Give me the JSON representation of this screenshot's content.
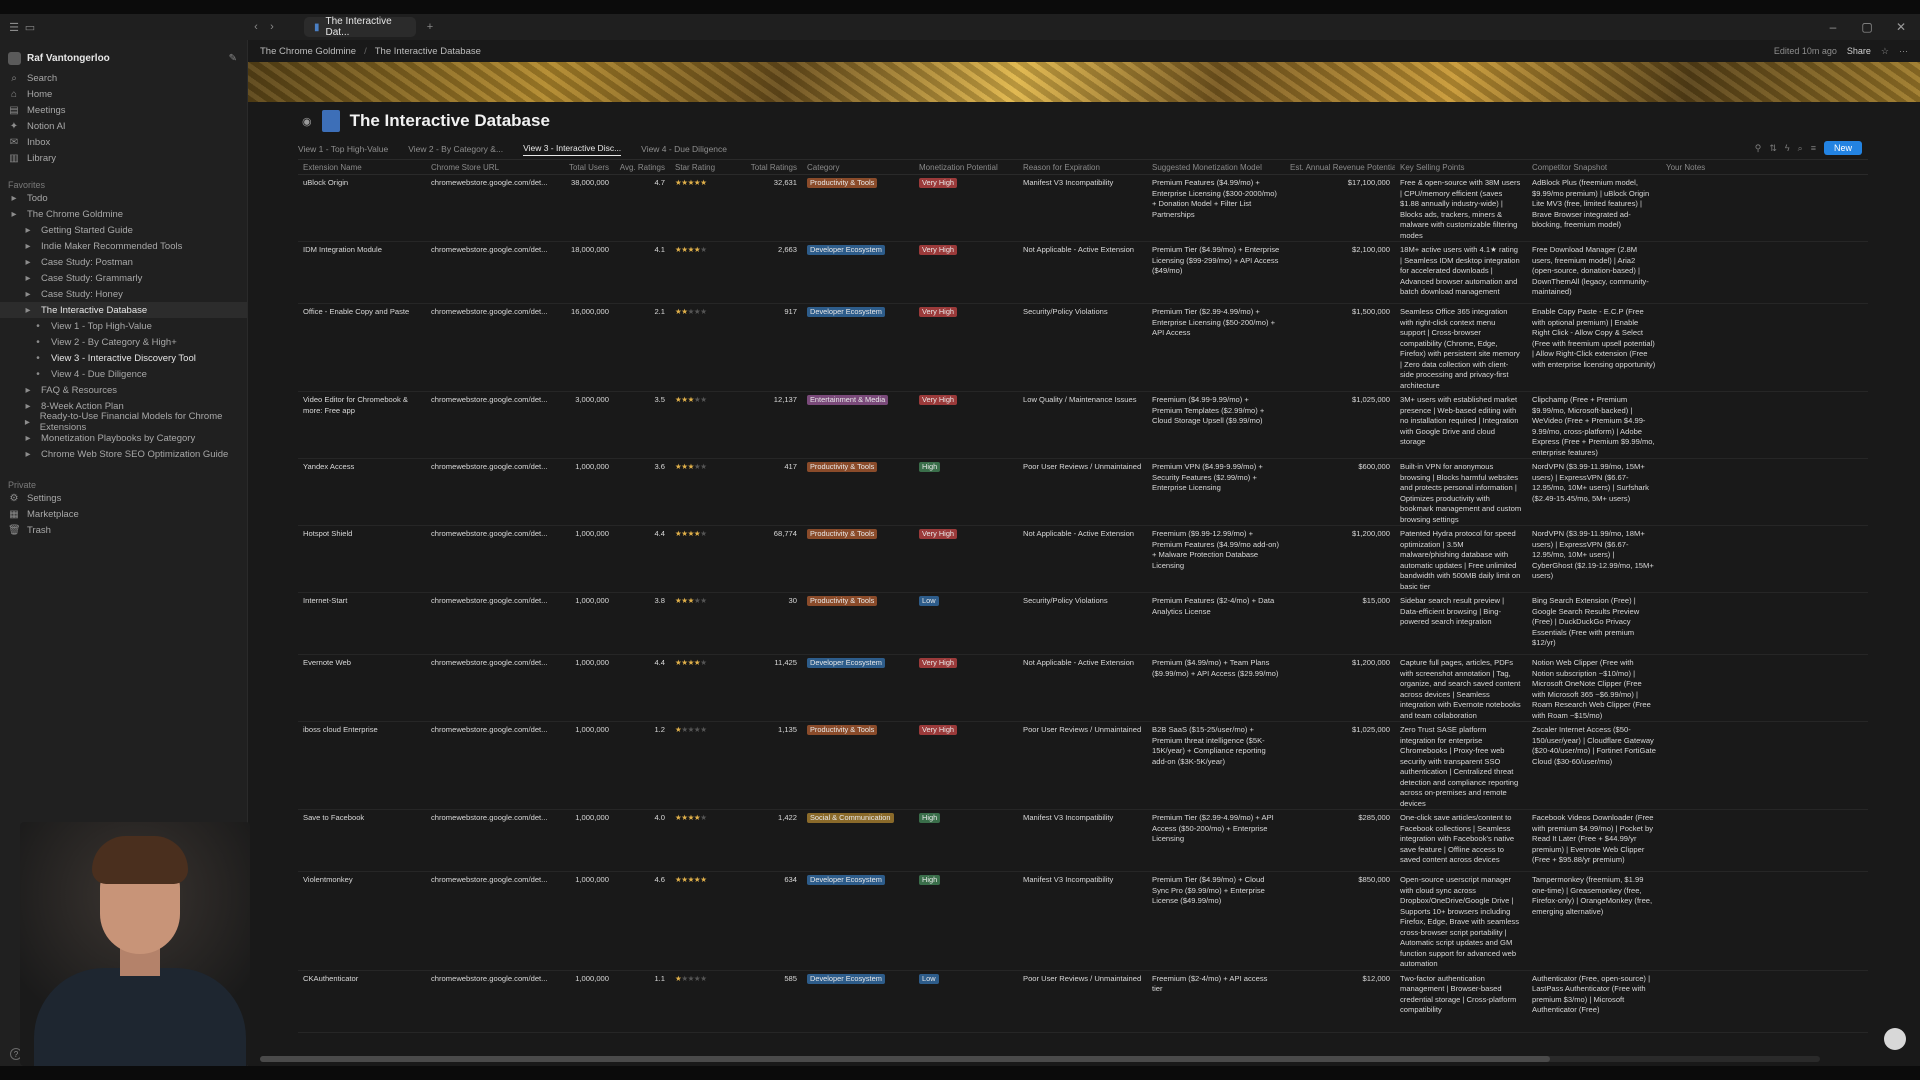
{
  "window": {
    "tab_title": "The Interactive Dat...",
    "new_tab": "+"
  },
  "sidebar": {
    "workspace": "Raf Vantongerloo",
    "top_items": [
      {
        "icon": "search-icon",
        "glyph": "⌕",
        "label": "Search"
      },
      {
        "icon": "home-icon",
        "glyph": "⌂",
        "label": "Home"
      },
      {
        "icon": "meetings-icon",
        "glyph": "▤",
        "label": "Meetings"
      },
      {
        "icon": "notion-ai-icon",
        "glyph": "✦",
        "label": "Notion AI"
      },
      {
        "icon": "inbox-icon",
        "glyph": "✉",
        "label": "Inbox"
      },
      {
        "icon": "library-icon",
        "glyph": "▥",
        "label": "Library"
      }
    ],
    "favorites_label": "Favorites",
    "favorites": [
      {
        "label": "Todo",
        "level": 0
      },
      {
        "label": "The Chrome Goldmine",
        "level": 0
      },
      {
        "label": "Getting Started Guide",
        "level": 1
      },
      {
        "label": "Indie Maker Recommended Tools",
        "level": 1
      },
      {
        "label": "Case Study: Postman",
        "level": 1
      },
      {
        "label": "Case Study: Grammarly",
        "level": 1
      },
      {
        "label": "Case Study: Honey",
        "level": 1
      },
      {
        "label": "The Interactive Database",
        "level": 1,
        "active": true
      },
      {
        "label": "View 1 - Top High-Value",
        "level": 2
      },
      {
        "label": "View 2 - By Category & High+",
        "level": 2
      },
      {
        "label": "View 3 - Interactive Discovery Tool",
        "level": 2,
        "bold": true
      },
      {
        "label": "View 4 - Due Diligence",
        "level": 2
      },
      {
        "label": "FAQ & Resources",
        "level": 1
      },
      {
        "label": "8-Week Action Plan",
        "level": 1
      },
      {
        "label": "Ready-to-Use Financial Models for Chrome Extensions",
        "level": 1
      },
      {
        "label": "Monetization Playbooks by Category",
        "level": 1
      },
      {
        "label": "Chrome Web Store SEO Optimization Guide",
        "level": 1
      }
    ],
    "private_label": "Private",
    "bottom_items": [
      {
        "icon": "settings-icon",
        "glyph": "⚙",
        "label": "Settings"
      },
      {
        "icon": "marketplace-icon",
        "glyph": "▦",
        "label": "Marketplace"
      },
      {
        "icon": "trash-icon",
        "glyph": "🗑",
        "label": "Trash"
      }
    ]
  },
  "topbar": {
    "breadcrumb_1": "The Chrome Goldmine",
    "breadcrumb_2": "The Interactive Database",
    "edited": "Edited 10m ago",
    "share": "Share"
  },
  "page": {
    "title": "The Interactive Database",
    "views": [
      "View 1 - Top High-Value",
      "View 2 - By Category &...",
      "View 3 - Interactive Disc...",
      "View 4 - Due Diligence"
    ],
    "active_view": 2,
    "new_button": "New"
  },
  "table": {
    "columns": [
      "Extension Name",
      "Chrome Store URL",
      "Total Users",
      "Avg. Ratings",
      "Star Rating",
      "Total Ratings",
      "Category",
      "Monetization Potential",
      "Reason for Expiration",
      "Suggested Monetization Model",
      "Est. Annual Revenue Potential",
      "Key Selling Points",
      "Competitor Snapshot",
      "Your Notes"
    ],
    "rows": [
      {
        "name": "uBlock Origin",
        "url": "chromewebstore.google.com/det...",
        "users": "38,000,000",
        "avg": "4.7",
        "stars": 5,
        "ratings": "32,631",
        "category": "Productivity & Tools",
        "cat_color": "#8a4b2a",
        "potential": "Very High",
        "pot_color": "#9b3a3a",
        "reason": "Manifest V3 Incompatibility",
        "model": "Premium Features ($4.99/mo) + Enterprise Licensing ($300-2000/mo) + Donation Model + Filter List Partnerships",
        "revenue": "$17,100,000",
        "points": "Free & open-source with 38M users | CPU/memory efficient (saves $1.88 annually industry-wide) | Blocks ads, trackers, miners & malware with customizable filtering modes",
        "competitor": "AdBlock Plus (freemium model, $9.99/mo premium) | uBlock Origin Lite MV3 (free, limited features) | Brave Browser integrated ad-blocking, freemium model)"
      },
      {
        "name": "IDM Integration Module",
        "url": "chromewebstore.google.com/det...",
        "users": "18,000,000",
        "avg": "4.1",
        "stars": 4,
        "ratings": "2,663",
        "category": "Developer Ecosystem",
        "cat_color": "#2d5c8a",
        "potential": "Very High",
        "pot_color": "#9b3a3a",
        "reason": "Not Applicable - Active Extension",
        "model": "Premium Tier ($4.99/mo) + Enterprise Licensing ($99-299/mo) + API Access ($49/mo)",
        "revenue": "$2,100,000",
        "points": "18M+ active users with 4.1★ rating | Seamless IDM desktop integration for accelerated downloads | Advanced browser automation and batch download management",
        "competitor": "Free Download Manager (2.8M users, freemium model) | Aria2 (open-source, donation-based) | DownThemAll (legacy, community-maintained)"
      },
      {
        "name": "Office - Enable Copy and Paste",
        "url": "chromewebstore.google.com/det...",
        "users": "16,000,000",
        "avg": "2.1",
        "stars": 2,
        "ratings": "917",
        "category": "Developer Ecosystem",
        "cat_color": "#2d5c8a",
        "potential": "Very High",
        "pot_color": "#9b3a3a",
        "reason": "Security/Policy Violations",
        "model": "Premium Tier ($2.99-4.99/mo) + Enterprise Licensing ($50-200/mo) + API Access",
        "revenue": "$1,500,000",
        "points": "Seamless Office 365 integration with right-click context menu support | Cross-browser compatibility (Chrome, Edge, Firefox) with persistent site memory | Zero data collection with client-side processing and privacy-first architecture",
        "competitor": "Enable Copy Paste - E.C.P (Free with optional premium) | Enable Right Click - Allow Copy & Select (Free with freemium upsell potential) | Allow Right-Click extension (Free with enterprise licensing opportunity)"
      },
      {
        "name": "Video Editor for Chromebook & more: Free app",
        "url": "chromewebstore.google.com/det...",
        "users": "3,000,000",
        "avg": "3.5",
        "stars": 3,
        "ratings": "12,137",
        "category": "Entertainment & Media",
        "cat_color": "#7a4a7a",
        "potential": "Very High",
        "pot_color": "#9b3a3a",
        "reason": "Low Quality / Maintenance Issues",
        "model": "Freemium ($4.99-9.99/mo) + Premium Templates ($2.99/mo) + Cloud Storage Upsell ($9.99/mo)",
        "revenue": "$1,025,000",
        "points": "3M+ users with established market presence | Web-based editing with no installation required | Integration with Google Drive and cloud storage",
        "competitor": "Clipchamp (Free + Premium $9.99/mo, Microsoft-backed) | WeVideo (Free + Premium $4.99-9.99/mo, cross-platform) | Adobe Express (Free + Premium $9.99/mo, enterprise features)"
      },
      {
        "name": "Yandex Access",
        "url": "chromewebstore.google.com/det...",
        "users": "1,000,000",
        "avg": "3.6",
        "stars": 3,
        "ratings": "417",
        "category": "Productivity & Tools",
        "cat_color": "#8a4b2a",
        "potential": "High",
        "pot_color": "#3a6e4a",
        "reason": "Poor User Reviews / Unmaintained",
        "model": "Premium VPN ($4.99-9.99/mo) + Security Features ($2.99/mo) + Enterprise Licensing",
        "revenue": "$600,000",
        "points": "Built-in VPN for anonymous browsing | Blocks harmful websites and protects personal information | Optimizes productivity with bookmark management and custom browsing settings",
        "competitor": "NordVPN ($3.99-11.99/mo, 15M+ users) | ExpressVPN ($6.67-12.95/mo, 10M+ users) | Surfshark ($2.49-15.45/mo, 5M+ users)"
      },
      {
        "name": "Hotspot Shield",
        "url": "chromewebstore.google.com/det...",
        "users": "1,000,000",
        "avg": "4.4",
        "stars": 4,
        "ratings": "68,774",
        "category": "Productivity & Tools",
        "cat_color": "#8a4b2a",
        "potential": "Very High",
        "pot_color": "#9b3a3a",
        "reason": "Not Applicable - Active Extension",
        "model": "Freemium ($9.99-12.99/mo) + Premium Features ($4.99/mo add-on) + Malware Protection Database Licensing",
        "revenue": "$1,200,000",
        "points": "Patented Hydra protocol for speed optimization | 3.5M malware/phishing database with automatic updates | Free unlimited bandwidth with 500MB daily limit on basic tier",
        "competitor": "NordVPN ($3.99-11.99/mo, 18M+ users) | ExpressVPN ($6.67-12.95/mo, 10M+ users) | CyberGhost ($2.19-12.99/mo, 15M+ users)"
      },
      {
        "name": "Internet-Start",
        "url": "chromewebstore.google.com/det...",
        "users": "1,000,000",
        "avg": "3.8",
        "stars": 3,
        "ratings": "30",
        "category": "Productivity & Tools",
        "cat_color": "#8a4b2a",
        "potential": "Low",
        "pot_color": "#2d5c8a",
        "reason": "Security/Policy Violations",
        "model": "Premium Features ($2-4/mo) + Data Analytics License",
        "revenue": "$15,000",
        "points": "Sidebar search result preview | Data-efficient browsing | Bing-powered search integration",
        "competitor": "Bing Search Extension (Free) | Google Search Results Preview (Free) | DuckDuckGo Privacy Essentials (Free with premium $12/yr)"
      },
      {
        "name": "Evernote Web",
        "url": "chromewebstore.google.com/det...",
        "users": "1,000,000",
        "avg": "4.4",
        "stars": 4,
        "ratings": "11,425",
        "category": "Developer Ecosystem",
        "cat_color": "#2d5c8a",
        "potential": "Very High",
        "pot_color": "#9b3a3a",
        "reason": "Not Applicable - Active Extension",
        "model": "Premium ($4.99/mo) + Team Plans ($9.99/mo) + API Access ($29.99/mo)",
        "revenue": "$1,200,000",
        "points": "Capture full pages, articles, PDFs with screenshot annotation | Tag, organize, and search saved content across devices | Seamless integration with Evernote notebooks and team collaboration",
        "competitor": "Notion Web Clipper (Free with Notion subscription ~$10/mo) | Microsoft OneNote Clipper (Free with Microsoft 365 ~$6.99/mo) | Roam Research Web Clipper (Free with Roam ~$15/mo)"
      },
      {
        "name": "iboss cloud Enterprise",
        "url": "chromewebstore.google.com/det...",
        "users": "1,000,000",
        "avg": "1.2",
        "stars": 1,
        "ratings": "1,135",
        "category": "Productivity & Tools",
        "cat_color": "#8a4b2a",
        "potential": "Very High",
        "pot_color": "#9b3a3a",
        "reason": "Poor User Reviews / Unmaintained",
        "model": "B2B SaaS ($15-25/user/mo) + Premium threat intelligence ($5K-15K/year) + Compliance reporting add-on ($3K-5K/year)",
        "revenue": "$1,025,000",
        "points": "Zero Trust SASE platform integration for enterprise Chromebooks | Proxy-free web security with transparent SSO authentication | Centralized threat detection and compliance reporting across on-premises and remote devices",
        "competitor": "Zscaler Internet Access ($50-150/user/year) | Cloudflare Gateway ($20-40/user/mo) | Fortinet FortiGate Cloud ($30-60/user/mo)"
      },
      {
        "name": "Save to Facebook",
        "url": "chromewebstore.google.com/det...",
        "users": "1,000,000",
        "avg": "4.0",
        "stars": 4,
        "ratings": "1,422",
        "category": "Social & Communication",
        "cat_color": "#8a6a2a",
        "potential": "High",
        "pot_color": "#3a6e4a",
        "reason": "Manifest V3 Incompatibility",
        "model": "Premium Tier ($2.99-4.99/mo) + API Access ($50-200/mo) + Enterprise Licensing",
        "revenue": "$285,000",
        "points": "One-click save articles/content to Facebook collections | Seamless integration with Facebook's native save feature | Offline access to saved content across devices",
        "competitor": "Facebook Videos Downloader (Free with premium $4.99/mo) | Pocket by Read It Later (Free + $44.99/yr premium) | Evernote Web Clipper (Free + $95.88/yr premium)"
      },
      {
        "name": "Violentmonkey",
        "url": "chromewebstore.google.com/det...",
        "users": "1,000,000",
        "avg": "4.6",
        "stars": 5,
        "ratings": "634",
        "category": "Developer Ecosystem",
        "cat_color": "#2d5c8a",
        "potential": "High",
        "pot_color": "#3a6e4a",
        "reason": "Manifest V3 Incompatibility",
        "model": "Premium Tier ($4.99/mo) + Cloud Sync Pro ($9.99/mo) + Enterprise License ($49.99/mo)",
        "revenue": "$850,000",
        "points": "Open-source userscript manager with cloud sync across Dropbox/OneDrive/Google Drive | Supports 10+ browsers including Firefox, Edge, Brave with seamless cross-browser script portability | Automatic script updates and GM function support for advanced web automation",
        "competitor": "Tampermonkey (freemium, $1.99 one-time) | Greasemonkey (free, Firefox-only) | OrangeMonkey (free, emerging alternative)"
      },
      {
        "name": "CKAuthenticator",
        "url": "chromewebstore.google.com/det...",
        "users": "1,000,000",
        "avg": "1.1",
        "stars": 1,
        "ratings": "585",
        "category": "Developer Ecosystem",
        "cat_color": "#2d5c8a",
        "potential": "Low",
        "pot_color": "#2d5c8a",
        "reason": "Poor User Reviews / Unmaintained",
        "model": "Freemium ($2-4/mo) + API access tier",
        "revenue": "$12,000",
        "points": "Two-factor authentication management | Browser-based credential storage | Cross-platform compatibility",
        "competitor": "Authenticator (Free, open-source) | LastPass Authenticator (Free with premium $3/mo) | Microsoft Authenticator (Free)"
      }
    ]
  }
}
